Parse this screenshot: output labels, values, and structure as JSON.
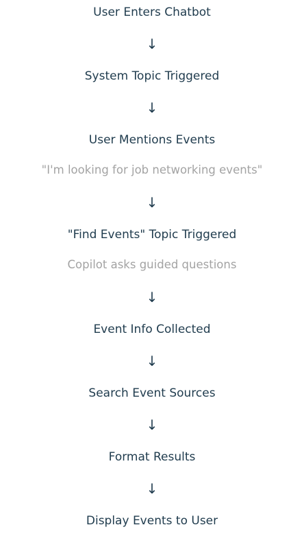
{
  "flow": {
    "step1": "User Enters Chatbot",
    "step2": "System Topic Triggered",
    "step3": "User Mentions Events",
    "note3": "\"I'm looking for job networking events\"",
    "step4": "\"Find Events\" Topic Triggered",
    "note4": "Copilot asks guided questions",
    "step5": "Event Info Collected",
    "step6": "Search Event Sources",
    "step7": "Format Results",
    "step8": "Display Events to User",
    "arrow": "↓"
  }
}
